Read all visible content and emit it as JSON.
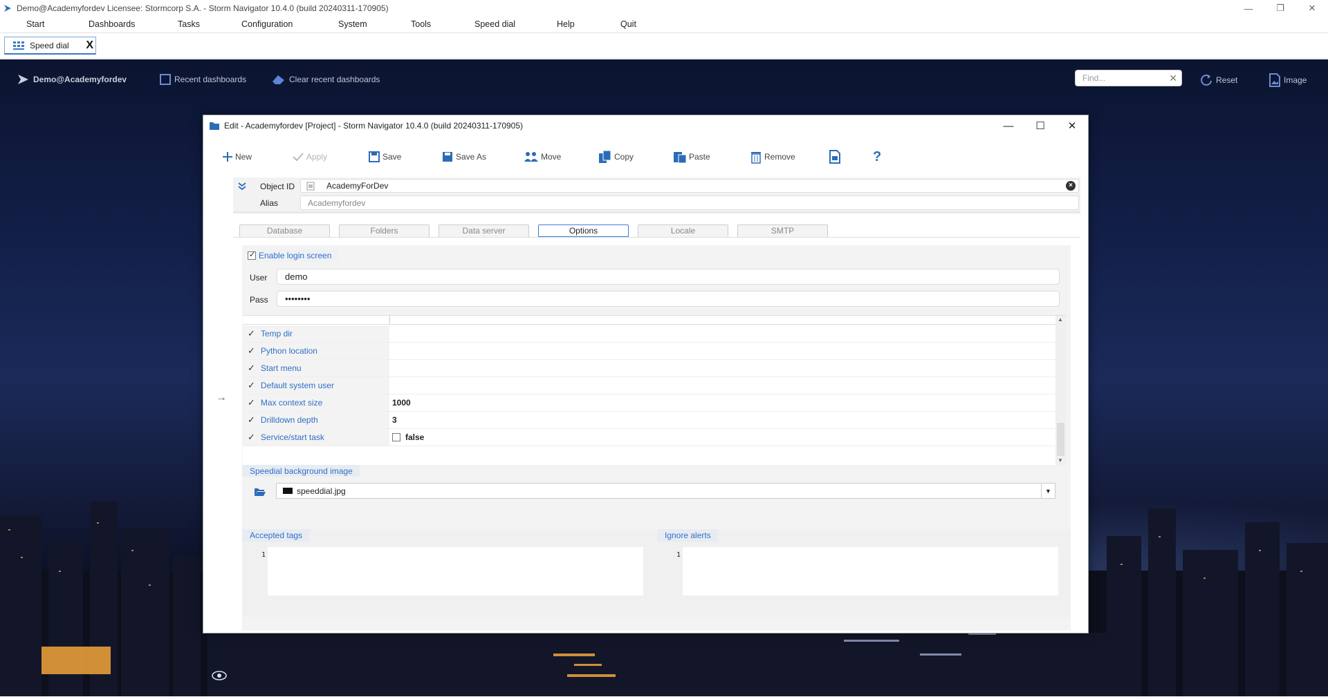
{
  "window": {
    "title": "Demo@Academyfordev    Licensee: Stormcorp S.A. -  Storm Navigator 10.4.0 (build 20240311-170905)",
    "controls": {
      "minimize": "—",
      "restore": "❐",
      "close": "✕"
    }
  },
  "menu": {
    "items": [
      {
        "label": "Start"
      },
      {
        "label": "Dashboards"
      },
      {
        "label": "Tasks"
      },
      {
        "label": "Configuration"
      },
      {
        "label": "System"
      },
      {
        "label": "Tools"
      },
      {
        "label": "Speed dial"
      },
      {
        "label": "Help"
      },
      {
        "label": "Quit"
      }
    ]
  },
  "tabs": {
    "active": {
      "label": "Speed dial",
      "close": "X"
    }
  },
  "speeddial": {
    "user": "Demo@Academyfordev",
    "recent": "Recent dashboards",
    "clear_recent": "Clear recent dashboards",
    "find_placeholder": "Find...",
    "find_clear": "✕",
    "reset": "Reset",
    "image": "Image"
  },
  "dialog": {
    "title": "Edit - Academyfordev [Project] -  Storm Navigator 10.4.0 (build 20240311-170905)",
    "controls": {
      "minimize": "—",
      "maximize": "☐",
      "close": "✕"
    },
    "toolbar": {
      "new": "New",
      "apply": "Apply",
      "save": "Save",
      "save_as": "Save As",
      "move": "Move",
      "copy": "Copy",
      "paste": "Paste",
      "remove": "Remove",
      "help": "?"
    },
    "object": {
      "id_label": "Object ID",
      "id_value": "AcademyForDev",
      "alias_label": "Alias",
      "alias_value": "Academyfordev"
    },
    "tabs": [
      {
        "label": "Database"
      },
      {
        "label": "Folders"
      },
      {
        "label": "Data server"
      },
      {
        "label": "Options",
        "active": true
      },
      {
        "label": "Locale"
      },
      {
        "label": "SMTP"
      }
    ],
    "options": {
      "enable_login_label": "Enable login screen",
      "enable_login_checked": true,
      "user_label": "User",
      "user_value": "demo",
      "pass_label": "Pass",
      "pass_value": "••••••••",
      "grid": [
        {
          "key": "Temp dir",
          "value": ""
        },
        {
          "key": "Python location",
          "value": ""
        },
        {
          "key": "Start menu",
          "value": ""
        },
        {
          "key": "Default system user",
          "value": ""
        },
        {
          "key": "Max context size",
          "value": "1000"
        },
        {
          "key": "Drilldown depth",
          "value": "3"
        },
        {
          "key": "Service/start task",
          "value": "false"
        }
      ],
      "bg_image_label": "Speedial background image",
      "bg_image_value": "speeddial.jpg",
      "accepted_tags_label": "Accepted tags",
      "ignore_alerts_label": "Ignore alerts",
      "line_number": "1"
    }
  }
}
